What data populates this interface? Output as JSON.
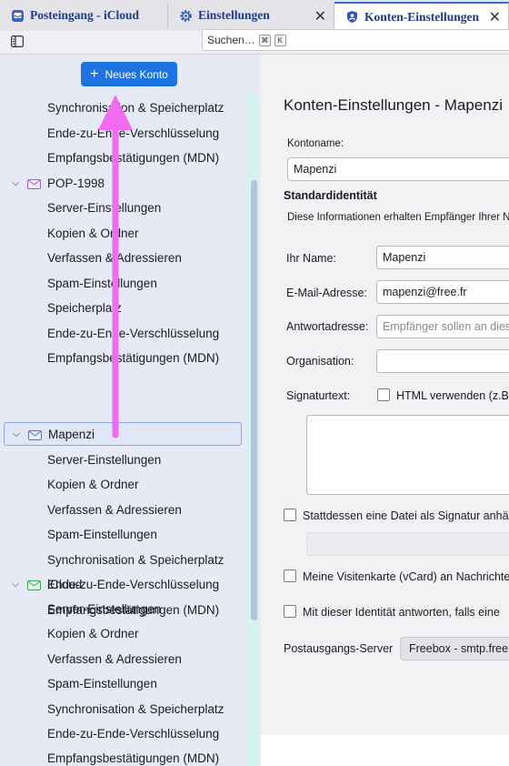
{
  "tabs": [
    {
      "label": "Posteingang - iCloud",
      "icon": "inbox-icon"
    },
    {
      "label": "Einstellungen",
      "icon": "gear-icon"
    },
    {
      "label": "Konten-Einstellungen",
      "icon": "account-icon"
    }
  ],
  "search": {
    "placeholder": "Suchen…",
    "shortcut_1": "⌘",
    "shortcut_2": "K"
  },
  "sidebar": {
    "new_account_label": "Neues Konto",
    "top_items": [
      "Synchronisation & Speicherplatz",
      "Ende-zu-Ende-Verschlüsselung",
      "Empfangsbestätigungen (MDN)"
    ],
    "accounts": [
      {
        "name": "POP-1998",
        "items": [
          "Server-Einstellungen",
          "Kopien & Ordner",
          "Verfassen & Adressieren",
          "Spam-Einstellungen",
          "Speicherplatz",
          "Ende-zu-Ende-Verschlüsselung",
          "Empfangsbestätigungen (MDN)"
        ]
      },
      {
        "name": "Mapenzi",
        "items": [
          "Server-Einstellungen",
          "Kopien & Ordner",
          "Verfassen & Adressieren",
          "Spam-Einstellungen",
          "Synchronisation & Speicherplatz",
          "Ende-zu-Ende-Verschlüsselung",
          "Empfangsbestätigungen (MDN)"
        ]
      },
      {
        "name": "iCloud",
        "items": [
          "Server-Einstellungen",
          "Kopien & Ordner",
          "Verfassen & Adressieren",
          "Spam-Einstellungen",
          "Synchronisation & Speicherplatz",
          "Ende-zu-Ende-Verschlüsselung",
          "Empfangsbestätigungen (MDN)"
        ]
      }
    ]
  },
  "main": {
    "title": "Konten-Einstellungen - Mapenzi",
    "account_name_label": "Kontoname:",
    "account_name_value": "Mapenzi",
    "identity_heading": "Standardidentität",
    "identity_desc": "Diese Informationen erhalten Empfänger Ihrer Nachrichten.",
    "name_label": "Ihr Name:",
    "name_value": "Mapenzi",
    "email_label": "E-Mail-Adresse:",
    "email_value": "mapenzi@free.fr",
    "reply_label": "Antwortadresse:",
    "reply_placeholder": "Empfänger sollen an diese andere Adresse antworten",
    "org_label": "Organisation:",
    "org_value": "",
    "sig_label": "Signaturtext:",
    "html_label": "HTML verwenden (z.B.",
    "sigfile_label": "Stattdessen eine Datei als Signatur anhängen",
    "vcard_label": "Meine Visitenkarte (vCard) an Nachrichten anhängen",
    "reply_identity_label": "Mit dieser Identität antworten, falls eine",
    "smtp_label": "Postausgangs-Server",
    "smtp_value": "Freebox - smtp.free.fr"
  },
  "colors": {
    "accent": "#1d74e0",
    "annotation_arrow": "#ef6cf0"
  }
}
